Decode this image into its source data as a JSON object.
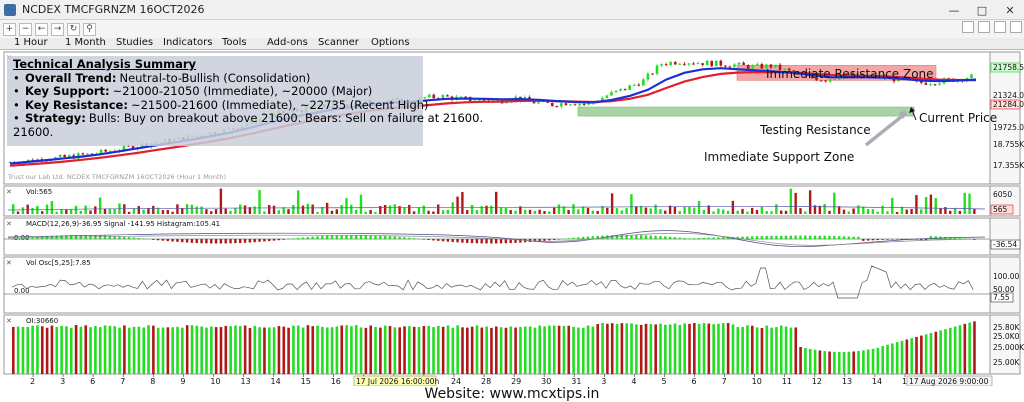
{
  "window": {
    "title": "NCDEX TMCFGRNZM 16OCT2026"
  },
  "menu": [
    "1 Hour",
    "1 Month",
    "Studies",
    "Indicators",
    "Tools",
    "Add-ons",
    "Scanner",
    "Options"
  ],
  "summary": {
    "heading": "Technical Analysis Summary",
    "items": [
      {
        "key": "Overall Trend:",
        "value": "Neutral-to-Bullish (Consolidation)"
      },
      {
        "key": "Key Support:",
        "value": "~21000-21050 (Immediate), ~20000 (Major)"
      },
      {
        "key": "Key Resistance:",
        "value": "~21500-21600 (Immediate), ~22735 (Recent High)"
      },
      {
        "key": "Strategy:",
        "value": "Bulls: Buy on breakout above 21600. Bears: Sell on failure at 21600."
      }
    ],
    "overflow": "21600."
  },
  "annotations": {
    "resistance_zone": "Immediate Resistance Zone",
    "support_zone": "Immediate Support Zone",
    "testing": "Testing Resistance",
    "current_price": "Current Price"
  },
  "price_panel": {
    "watermark": "Trust our Lab Ltd. NCDEX TMCFGRNZM 16OCT2026 (Hour 1 Month)",
    "y_ticks": [
      "21758.5",
      "21324.0",
      "21284.0",
      "19725.00",
      "18.755K",
      "17.355K"
    ],
    "y_tick_values": [
      21758.5,
      21324,
      21284,
      19725,
      18755,
      17355
    ]
  },
  "volume_panel": {
    "label": "Vol:565",
    "y_ticks": [
      "6050",
      "565"
    ]
  },
  "macd_panel": {
    "label": "MACD(12,26,9)-36.95 Signal -141.95 Histagram:105.41",
    "zero": "0.00",
    "y_tick": "-36.54"
  },
  "volosc_panel": {
    "label": "Vol Osc[5,25]:7.85",
    "zero": "0.00",
    "y_ticks": [
      "100.00",
      "50.00",
      "7.55"
    ]
  },
  "oi_panel": {
    "label": "OI:30660",
    "y_ticks": [
      "25.80K",
      "25.0K0",
      "25.000K",
      "25.00K"
    ]
  },
  "x_axis": {
    "ticks": [
      "2",
      "3",
      "6",
      "7",
      "8",
      "9",
      "10",
      "13",
      "14",
      "15",
      "16",
      "17",
      "22",
      "23",
      "24",
      "28",
      "29",
      "30",
      "31",
      "3",
      "4",
      "5",
      "6",
      "7",
      "10",
      "11",
      "12",
      "13",
      "14",
      "17"
    ],
    "months": [
      "Jul 2026",
      "Aug 2026"
    ],
    "crosshair_left": "17 Jul 2026 16:00:00h",
    "crosshair_right": "17 Aug 2026 9:00:00"
  },
  "footer": "Website: www.mcxtips.in",
  "colors": {
    "ema_fast": "#1a2fd6",
    "ema_slow": "#e0202a",
    "bull": "#22dd22",
    "bear": "#b01818",
    "resistance": "#f4a5a5",
    "support": "#a8d4a4"
  },
  "chart_data": {
    "type": "candlestick",
    "symbol": "NCDEX TMCFGRNZM 16OCT2026",
    "interval": "1 Hour",
    "x_ticks": [
      "2",
      "3",
      "6",
      "7",
      "8",
      "9",
      "10",
      "13",
      "14",
      "15",
      "16",
      "17",
      "22",
      "23",
      "24",
      "28",
      "29",
      "30",
      "31",
      "3",
      "4",
      "5",
      "6",
      "7",
      "10",
      "11",
      "12",
      "13",
      "14",
      "17"
    ],
    "price_close_path": [
      17500,
      17550,
      17650,
      17700,
      17800,
      17900,
      18050,
      18200,
      18350,
      18450,
      18600,
      18750,
      18900,
      19150,
      19400,
      19650,
      19800,
      19900,
      20050,
      20100,
      20150,
      20250,
      20100,
      20350,
      20400,
      20300,
      20250,
      20200,
      20350,
      20150,
      20050,
      20150,
      20050,
      20450,
      20750,
      21100,
      21850,
      21950,
      21900,
      21850,
      21800,
      21700,
      21750,
      21500,
      21250,
      21150,
      21350,
      21300,
      21250,
      21150,
      21000,
      21050,
      21150,
      21284
    ],
    "ema_fast": [
      17450,
      17520,
      17600,
      17680,
      17760,
      17860,
      17990,
      18120,
      18250,
      18380,
      18510,
      18650,
      18800,
      18990,
      19200,
      19400,
      19570,
      19720,
      19860,
      19960,
      20050,
      20140,
      20160,
      20240,
      20300,
      20310,
      20300,
      20280,
      20290,
      20260,
      20200,
      20160,
      20140,
      20250,
      20430,
      20700,
      21150,
      21450,
      21600,
      21650,
      21600,
      21550,
      21500,
      21450,
      21350,
      21250,
      21250,
      21250,
      21230,
      21180,
      21100,
      21080,
      21110,
      21150
    ],
    "ema_slow": [
      17350,
      17410,
      17470,
      17540,
      17620,
      17710,
      17810,
      17920,
      18040,
      18160,
      18290,
      18420,
      18560,
      18720,
      18900,
      19080,
      19250,
      19410,
      19560,
      19690,
      19800,
      19900,
      19960,
      20030,
      20100,
      20150,
      20170,
      20180,
      20210,
      20220,
      20200,
      20180,
      20160,
      20200,
      20300,
      20480,
      20780,
      21060,
      21260,
      21400,
      21460,
      21480,
      21480,
      21460,
      21410,
      21350,
      21330,
      21310,
      21290,
      21250,
      21190,
      21150,
      21130,
      21120
    ],
    "resistance_zone": [
      21500,
      21600
    ],
    "support_zone": [
      19725,
      19850
    ],
    "levels": {
      "immediate_resistance": [
        21500,
        21600
      ],
      "recent_high": 22735,
      "immediate_support": [
        21000,
        21050
      ],
      "major_support": 20000,
      "current_price": 21284
    },
    "volume_last": 565,
    "macd": {
      "macd": -36.95,
      "signal": -141.95,
      "histogram": 105.41
    },
    "vol_osc": 7.85,
    "open_interest": 30660
  }
}
